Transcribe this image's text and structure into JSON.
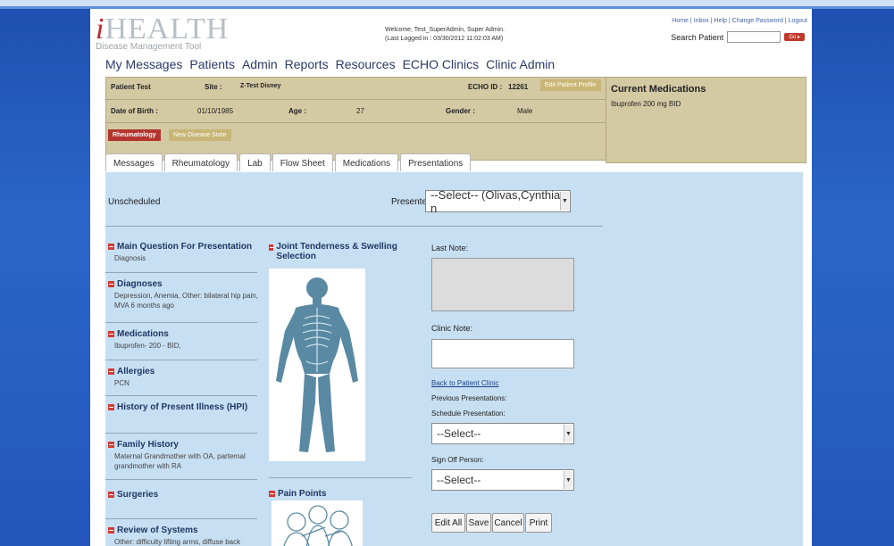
{
  "brand": {
    "logo_i": "i",
    "logo_word": "HEALTH",
    "tagline": "Disease Management Tool"
  },
  "welcome": {
    "line1": "Welcome, Test_SuperAdmin, Super Admin.",
    "line2": "(Last Logged in : 03/30/2012 11:02:03 AM)"
  },
  "toplinks": [
    "Home",
    "Inbox",
    "Help",
    "Change Password",
    "Logout"
  ],
  "search": {
    "label": "Search Patient",
    "go": "Go ▸"
  },
  "mainnav": [
    "My Messages",
    "Patients",
    "Admin",
    "Reports",
    "Resources",
    "ECHO Clinics",
    "Clinic Admin"
  ],
  "patient": {
    "name": "Patient Test",
    "site_label": "Site :",
    "site_value": "Z-Test Disney",
    "echo_label": "ECHO ID :",
    "echo_value": "12261",
    "edit_btn": "Edit Patient Profile",
    "dob_label": "Date of Birth :",
    "dob_value": "01/10/1985",
    "age_label": "Age :",
    "age_value": "27",
    "gender_label": "Gender :",
    "gender_value": "Male",
    "disease_tab": "Rheumatology",
    "new_disease": "New Disease State"
  },
  "current_meds": {
    "title": "Current Medications",
    "item": "Ibuprofen 200 mg BID"
  },
  "tabs": [
    "Messages",
    "Rheumatology",
    "Lab",
    "Flow Sheet",
    "Medications",
    "Presentations"
  ],
  "presentation": {
    "status": "Unscheduled",
    "presenter_label": "Presenter:",
    "presenter_value": "--Select-- (Olivas,Cynthia n"
  },
  "sections": [
    {
      "title": "Main Question For Presentation",
      "body": "Diagnosis"
    },
    {
      "title": "Diagnoses",
      "body": "Depression, Anemia, Other: bilateral hip pain, MVA 6 months ago"
    },
    {
      "title": "Medications",
      "body": "Ibuprofen- 200 - BID,"
    },
    {
      "title": "Allergies",
      "body": "PCN"
    },
    {
      "title": "History of Present Illness (HPI)",
      "body": ""
    },
    {
      "title": "Family History",
      "body": "Maternal Grandmother with OA, parternal grandmother with RA"
    },
    {
      "title": "Surgeries",
      "body": ""
    },
    {
      "title": "Review of Systems",
      "body": "Other: difficulty lifting arms, diffuse back"
    }
  ],
  "middle": {
    "joint_title": "Joint Tenderness & Swelling Selection",
    "pain_title": "Pain Points"
  },
  "notes": {
    "last_note": "Last Note:",
    "clinic_note": "Clinic Note:",
    "back_link": "Back to Patient Clinic",
    "prev_pres": "Previous Presentations:",
    "schedule_label": "Schedule Presentation:",
    "schedule_value": "--Select--",
    "signoff_label": "Sign Off Person:",
    "signoff_value": "--Select--"
  },
  "actions": [
    "Edit All",
    "Save",
    "Cancel",
    "Print"
  ],
  "colors": {
    "accent_red": "#c0272d",
    "tan_panel": "#d3c9a3",
    "content_blue": "#c7dff2",
    "nav_text": "#2a3a66"
  }
}
